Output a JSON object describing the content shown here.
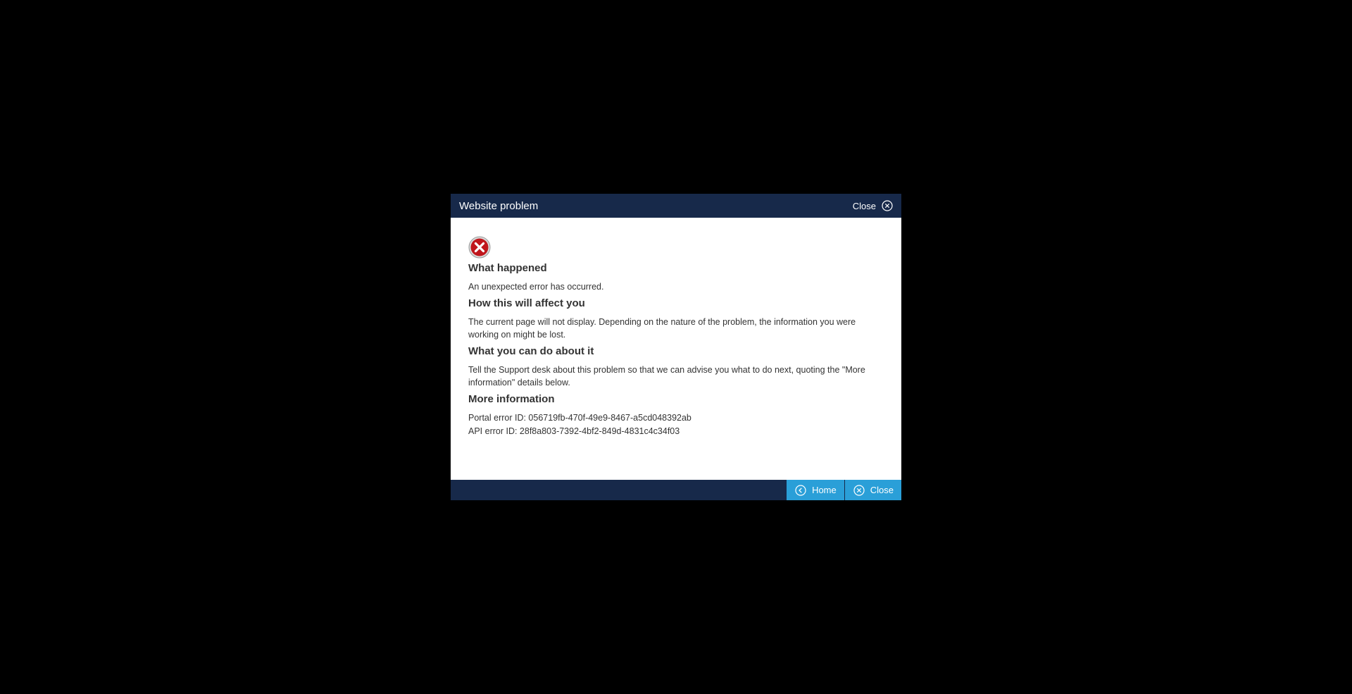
{
  "dialog": {
    "title": "Website problem",
    "header_close_label": "Close",
    "header_close_icon": "close-circle-icon",
    "error_icon": "error-x-icon",
    "error_icon_color": "#c0161c",
    "header_color": "#17294a",
    "button_color": "#2a9fd8",
    "sections": {
      "what_happened": {
        "heading": "What happened",
        "text": "An unexpected error has occurred."
      },
      "how_affect": {
        "heading": "How this will affect you",
        "text": "The current page will not display. Depending on the nature of the problem, the information you were working on might be lost."
      },
      "what_to_do": {
        "heading": "What you can do about it",
        "text": "Tell the Support desk about this problem so that we can advise you what to do next, quoting the \"More information\" details below."
      },
      "more_info": {
        "heading": "More information",
        "portal_error": "Portal error ID: 056719fb-470f-49e9-8467-a5cd048392ab",
        "api_error": "API error ID: 28f8a803-7392-4bf2-849d-4831c4c34f03"
      }
    },
    "footer": {
      "home_label": "Home",
      "home_icon": "chevron-left-circle-icon",
      "close_label": "Close",
      "close_icon": "close-circle-icon"
    }
  }
}
